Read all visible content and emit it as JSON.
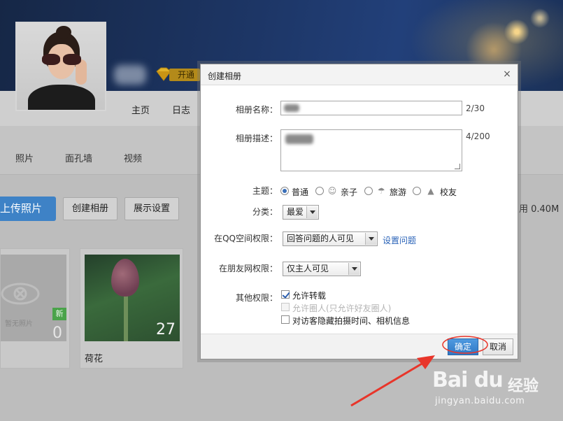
{
  "header": {
    "vip_label": "开通"
  },
  "nav": {
    "items": [
      "主页",
      "日志"
    ]
  },
  "subnav": {
    "items": [
      "照片",
      "面孔墙",
      "视频"
    ]
  },
  "toolbar": {
    "upload_label": "上传照片",
    "create_album_label": "创建相册",
    "display_settings_label": "展示设置",
    "storage_text": "用 0.40M"
  },
  "albums": [
    {
      "title": "",
      "empty_text": "暂无照片",
      "badge": "新",
      "count": "0"
    },
    {
      "title": "荷花",
      "count": "27"
    }
  ],
  "dialog": {
    "title": "创建相册",
    "close_icon": "×",
    "name_label": "相册名称：",
    "name_counter": "2/30",
    "desc_label": "相册描述：",
    "desc_counter": "4/200",
    "theme_label": "主题：",
    "themes": [
      "普通",
      "亲子",
      "旅游",
      "校友"
    ],
    "theme_selected": "普通",
    "category_label": "分类：",
    "category_value": "最爱",
    "qq_perm_label": "在QQ空间权限：",
    "qq_perm_value": "回答问题的人可见",
    "set_question_link": "设置问题",
    "friend_perm_label": "在朋友网权限：",
    "friend_perm_value": "仅主人可见",
    "other_perm_label": "其他权限：",
    "other_options": [
      {
        "label": "允许转载",
        "checked": true,
        "disabled": false
      },
      {
        "label": "允许圈人(只允许好友圈人)",
        "checked": false,
        "disabled": true
      },
      {
        "label": "对访客隐藏拍摄时间、相机信息",
        "checked": false,
        "disabled": false
      }
    ],
    "ok_label": "确定",
    "cancel_label": "取消"
  },
  "annotation_colors": {
    "arrow": "#e8352a",
    "ellipse": "#e8352a"
  },
  "watermark": {
    "logo": "Bai du",
    "cn": "经验",
    "url": "jingyan.baidu.com"
  }
}
